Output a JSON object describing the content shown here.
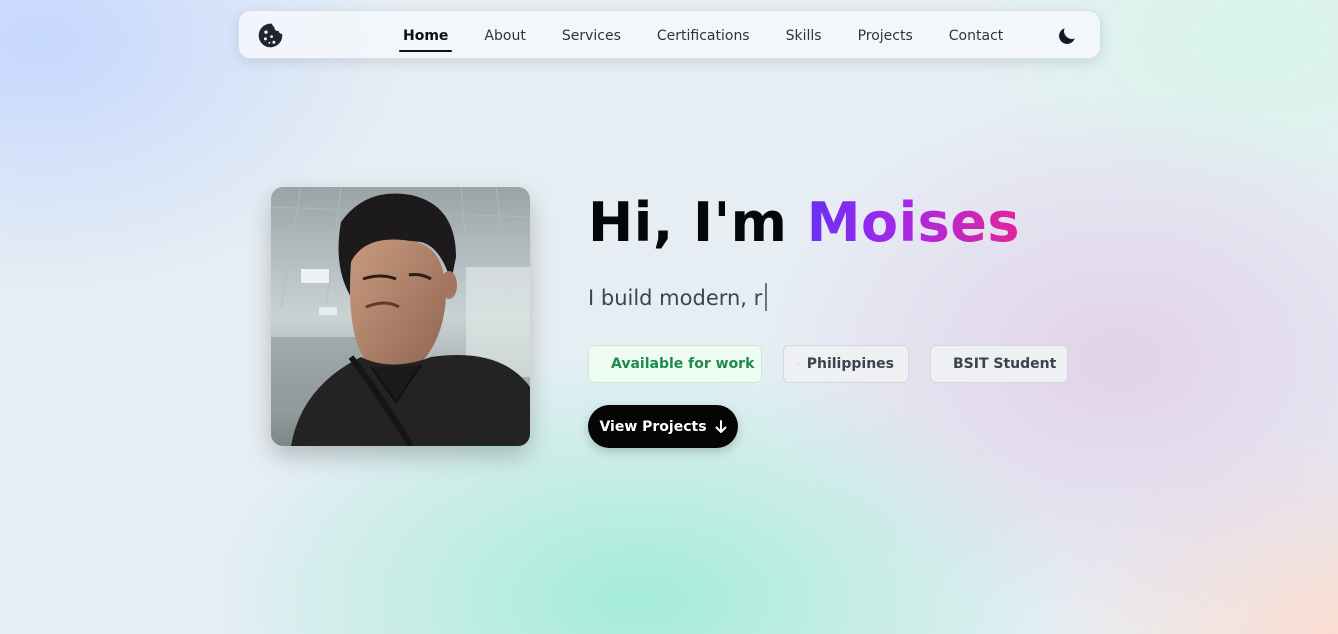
{
  "navbar": {
    "logo_icon": "cookie-icon",
    "links": [
      {
        "label": "Home",
        "active": true
      },
      {
        "label": "About",
        "active": false
      },
      {
        "label": "Services",
        "active": false
      },
      {
        "label": "Certifications",
        "active": false
      },
      {
        "label": "Skills",
        "active": false
      },
      {
        "label": "Projects",
        "active": false
      },
      {
        "label": "Contact",
        "active": false
      }
    ],
    "theme_toggle_icon": "moon-icon"
  },
  "hero": {
    "greeting": "Hi, I'm",
    "name": "Moises",
    "name_gradient": [
      "#6a2ff5",
      "#a728e6",
      "#e2259a"
    ],
    "subtitle_typed": "I build modern, r",
    "badges": {
      "available": {
        "label": "Available for work",
        "icon": "broadcast-icon",
        "color": "#1f8a4c"
      },
      "location": {
        "label": "Philippines",
        "icon": "map-pin-icon"
      },
      "role": {
        "label": "BSIT Student",
        "icon": "briefcase-icon"
      }
    },
    "cta": {
      "label": "View Projects",
      "icon": "arrow-down-icon"
    }
  }
}
